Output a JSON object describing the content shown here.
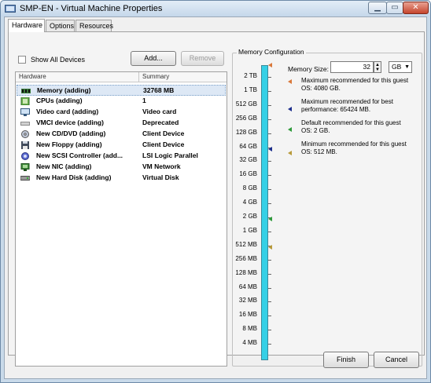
{
  "window": {
    "title": "SMP-EN - Virtual Machine Properties"
  },
  "tabs": [
    {
      "label": "Hardware",
      "active": true
    },
    {
      "label": "Options",
      "active": false
    },
    {
      "label": "Resources",
      "active": false
    }
  ],
  "hardware": {
    "show_all_devices_label": "Show All Devices",
    "show_all_devices_checked": false,
    "add_label": "Add...",
    "remove_label": "Remove",
    "columns": {
      "hardware": "Hardware",
      "summary": "Summary"
    },
    "rows": [
      {
        "name": "Memory (adding)",
        "summary": "32768 MB",
        "icon": "memory-icon",
        "selected": true
      },
      {
        "name": "CPUs (adding)",
        "summary": "1",
        "icon": "cpu-icon"
      },
      {
        "name": "Video card  (adding)",
        "summary": "Video card",
        "icon": "video-card-icon"
      },
      {
        "name": "VMCI device (adding)",
        "summary": "Deprecated",
        "icon": "vmci-icon"
      },
      {
        "name": "New CD/DVD (adding)",
        "summary": "Client Device",
        "icon": "cd-dvd-icon"
      },
      {
        "name": "New Floppy (adding)",
        "summary": "Client Device",
        "icon": "floppy-icon"
      },
      {
        "name": "New SCSI Controller (add...",
        "summary": "LSI Logic Parallel",
        "icon": "scsi-controller-icon"
      },
      {
        "name": "New NIC (adding)",
        "summary": "VM Network",
        "icon": "nic-icon"
      },
      {
        "name": "New Hard Disk (adding)",
        "summary": "Virtual Disk",
        "icon": "hard-disk-icon"
      }
    ]
  },
  "memory": {
    "group_title": "Memory Configuration",
    "size_label": "Memory Size:",
    "size_value": "32",
    "unit": "GB",
    "scale_labels": [
      "2 TB",
      "1 TB",
      "512 GB",
      "256 GB",
      "128 GB",
      "64 GB",
      "32 GB",
      "16 GB",
      "8 GB",
      "4 GB",
      "2 GB",
      "1 GB",
      "512 MB",
      "256 MB",
      "128 MB",
      "64 MB",
      "32 MB",
      "16 MB",
      "8 MB",
      "4 MB"
    ],
    "legend": [
      {
        "text": "Maximum recommended for this guest OS: 4080 GB.",
        "color": "#d9783a"
      },
      {
        "text": "Maximum recommended for best performance: 65424 MB.",
        "color": "#1c2e8c"
      },
      {
        "text": "Default recommended for this guest OS: 2 GB.",
        "color": "#2e9a3a"
      },
      {
        "text": "Minimum recommended for this guest OS: 512 MB.",
        "color": "#b89a3a"
      }
    ]
  },
  "footer": {
    "finish_label": "Finish",
    "cancel_label": "Cancel"
  }
}
